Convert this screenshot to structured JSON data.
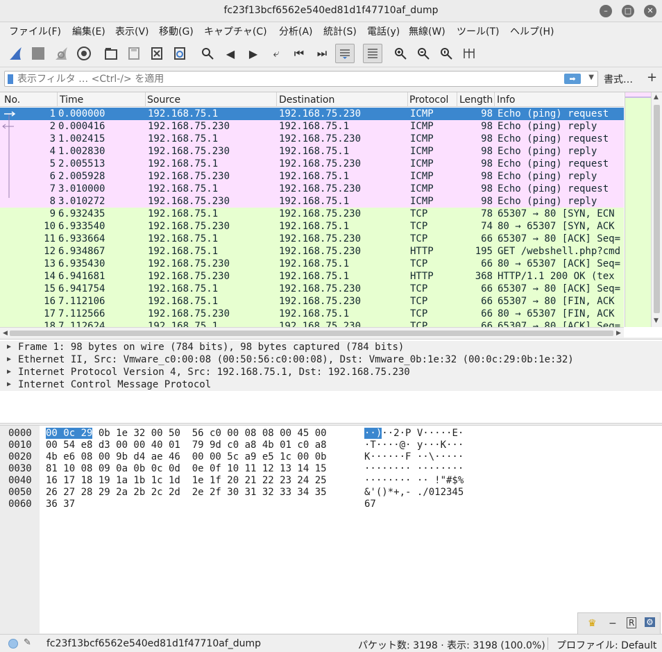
{
  "window": {
    "title": "fc23f13bcf6562e540ed81d1f47710af_dump"
  },
  "menu": [
    "ファイル(F)",
    "編集(E)",
    "表示(V)",
    "移動(G)",
    "キャプチャ(C)",
    "分析(A)",
    "統計(S)",
    "電話(y)",
    "無線(W)",
    "ツール(T)",
    "ヘルプ(H)"
  ],
  "toolbar_icons": [
    "shark-fin-start-icon",
    "stop-square-icon",
    "restart-fin-icon",
    "gear-options-icon",
    "open-folder-icon",
    "save-icon",
    "close-file-icon",
    "reload-icon",
    "search-icon",
    "go-back-icon",
    "go-forward-icon",
    "go-to-packet-icon",
    "first-packet-icon",
    "last-packet-icon",
    "autoscroll-icon",
    "colorize-icon",
    "zoom-in-icon",
    "zoom-out-icon",
    "normal-size-icon",
    "resize-columns-icon"
  ],
  "filter": {
    "placeholder": "表示フィルタ … <Ctrl-/> を適用",
    "value": "",
    "expression_label": "書式…",
    "plus_label": "+"
  },
  "columns": [
    "No.",
    "Time",
    "Source",
    "Destination",
    "Protocol",
    "Length",
    "Info"
  ],
  "packets": [
    {
      "no": "1",
      "time": "0.000000",
      "src": "192.168.75.1",
      "dst": "192.168.75.230",
      "proto": "ICMP",
      "len": "98",
      "info": "Echo (ping) request"
    },
    {
      "no": "2",
      "time": "0.000416",
      "src": "192.168.75.230",
      "dst": "192.168.75.1",
      "proto": "ICMP",
      "len": "98",
      "info": "Echo (ping) reply"
    },
    {
      "no": "3",
      "time": "1.002415",
      "src": "192.168.75.1",
      "dst": "192.168.75.230",
      "proto": "ICMP",
      "len": "98",
      "info": "Echo (ping) request"
    },
    {
      "no": "4",
      "time": "1.002830",
      "src": "192.168.75.230",
      "dst": "192.168.75.1",
      "proto": "ICMP",
      "len": "98",
      "info": "Echo (ping) reply"
    },
    {
      "no": "5",
      "time": "2.005513",
      "src": "192.168.75.1",
      "dst": "192.168.75.230",
      "proto": "ICMP",
      "len": "98",
      "info": "Echo (ping) request"
    },
    {
      "no": "6",
      "time": "2.005928",
      "src": "192.168.75.230",
      "dst": "192.168.75.1",
      "proto": "ICMP",
      "len": "98",
      "info": "Echo (ping) reply"
    },
    {
      "no": "7",
      "time": "3.010000",
      "src": "192.168.75.1",
      "dst": "192.168.75.230",
      "proto": "ICMP",
      "len": "98",
      "info": "Echo (ping) request"
    },
    {
      "no": "8",
      "time": "3.010272",
      "src": "192.168.75.230",
      "dst": "192.168.75.1",
      "proto": "ICMP",
      "len": "98",
      "info": "Echo (ping) reply"
    },
    {
      "no": "9",
      "time": "6.932435",
      "src": "192.168.75.1",
      "dst": "192.168.75.230",
      "proto": "TCP",
      "len": "78",
      "info": "65307 → 80 [SYN, ECN"
    },
    {
      "no": "10",
      "time": "6.933540",
      "src": "192.168.75.230",
      "dst": "192.168.75.1",
      "proto": "TCP",
      "len": "74",
      "info": "80 → 65307 [SYN, ACK"
    },
    {
      "no": "11",
      "time": "6.933664",
      "src": "192.168.75.1",
      "dst": "192.168.75.230",
      "proto": "TCP",
      "len": "66",
      "info": "65307 → 80 [ACK] Seq="
    },
    {
      "no": "12",
      "time": "6.934867",
      "src": "192.168.75.1",
      "dst": "192.168.75.230",
      "proto": "HTTP",
      "len": "195",
      "info": "GET /webshell.php?cmd"
    },
    {
      "no": "13",
      "time": "6.935430",
      "src": "192.168.75.230",
      "dst": "192.168.75.1",
      "proto": "TCP",
      "len": "66",
      "info": "80 → 65307 [ACK] Seq="
    },
    {
      "no": "14",
      "time": "6.941681",
      "src": "192.168.75.230",
      "dst": "192.168.75.1",
      "proto": "HTTP",
      "len": "368",
      "info": "HTTP/1.1 200 OK  (tex"
    },
    {
      "no": "15",
      "time": "6.941754",
      "src": "192.168.75.1",
      "dst": "192.168.75.230",
      "proto": "TCP",
      "len": "66",
      "info": "65307 → 80 [ACK] Seq="
    },
    {
      "no": "16",
      "time": "7.112106",
      "src": "192.168.75.1",
      "dst": "192.168.75.230",
      "proto": "TCP",
      "len": "66",
      "info": "65307 → 80 [FIN, ACK"
    },
    {
      "no": "17",
      "time": "7.112566",
      "src": "192.168.75.230",
      "dst": "192.168.75.1",
      "proto": "TCP",
      "len": "66",
      "info": "80 → 65307 [FIN, ACK"
    },
    {
      "no": "18",
      "time": "7.112624",
      "src": "192.168.75.1",
      "dst": "192.168.75.230",
      "proto": "TCP",
      "len": "66",
      "info": "65307 → 80 [ACK] Seq="
    }
  ],
  "details": [
    "Frame 1: 98 bytes on wire (784 bits), 98 bytes captured (784 bits)",
    "Ethernet II, Src: Vmware_c0:00:08 (00:50:56:c0:00:08), Dst: Vmware_0b:1e:32 (00:0c:29:0b:1e:32)",
    "Internet Protocol Version 4, Src: 192.168.75.1, Dst: 192.168.75.230",
    "Internet Control Message Protocol"
  ],
  "bytes": [
    {
      "off": "0000",
      "hex_sel": "00 0c 29",
      "hex": " 0b 1e 32 00 50  56 c0 00 08 08 00 45 00",
      "asc_sel": "··)",
      "asc": "··2·P V·····E·"
    },
    {
      "off": "0010",
      "hex_sel": "",
      "hex": "00 54 e8 d3 00 00 40 01  79 9d c0 a8 4b 01 c0 a8",
      "asc_sel": "",
      "asc": "·T····@· y···K···"
    },
    {
      "off": "0020",
      "hex_sel": "",
      "hex": "4b e6 08 00 9b d4 ae 46  00 00 5c a9 e5 1c 00 0b",
      "asc_sel": "",
      "asc": "K······F ··\\·····"
    },
    {
      "off": "0030",
      "hex_sel": "",
      "hex": "81 10 08 09 0a 0b 0c 0d  0e 0f 10 11 12 13 14 15",
      "asc_sel": "",
      "asc": "········ ········"
    },
    {
      "off": "0040",
      "hex_sel": "",
      "hex": "16 17 18 19 1a 1b 1c 1d  1e 1f 20 21 22 23 24 25",
      "asc_sel": "",
      "asc": "········ ·· !\"#$%"
    },
    {
      "off": "0050",
      "hex_sel": "",
      "hex": "26 27 28 29 2a 2b 2c 2d  2e 2f 30 31 32 33 34 35",
      "asc_sel": "",
      "asc": "&'()*+,- ./012345"
    },
    {
      "off": "0060",
      "hex_sel": "",
      "hex": "36 37",
      "asc_sel": "",
      "asc": "67"
    }
  ],
  "status": {
    "file": "fc23f13bcf6562e540ed81d1f47710af_dump",
    "packets": "パケット数: 3198 · 表示: 3198 (100.0%)",
    "profile": "プロファイル: Default"
  },
  "colors": {
    "icmp": "#fce0ff",
    "tcp": "#e7ffd0",
    "selected": "#3b87cf"
  }
}
